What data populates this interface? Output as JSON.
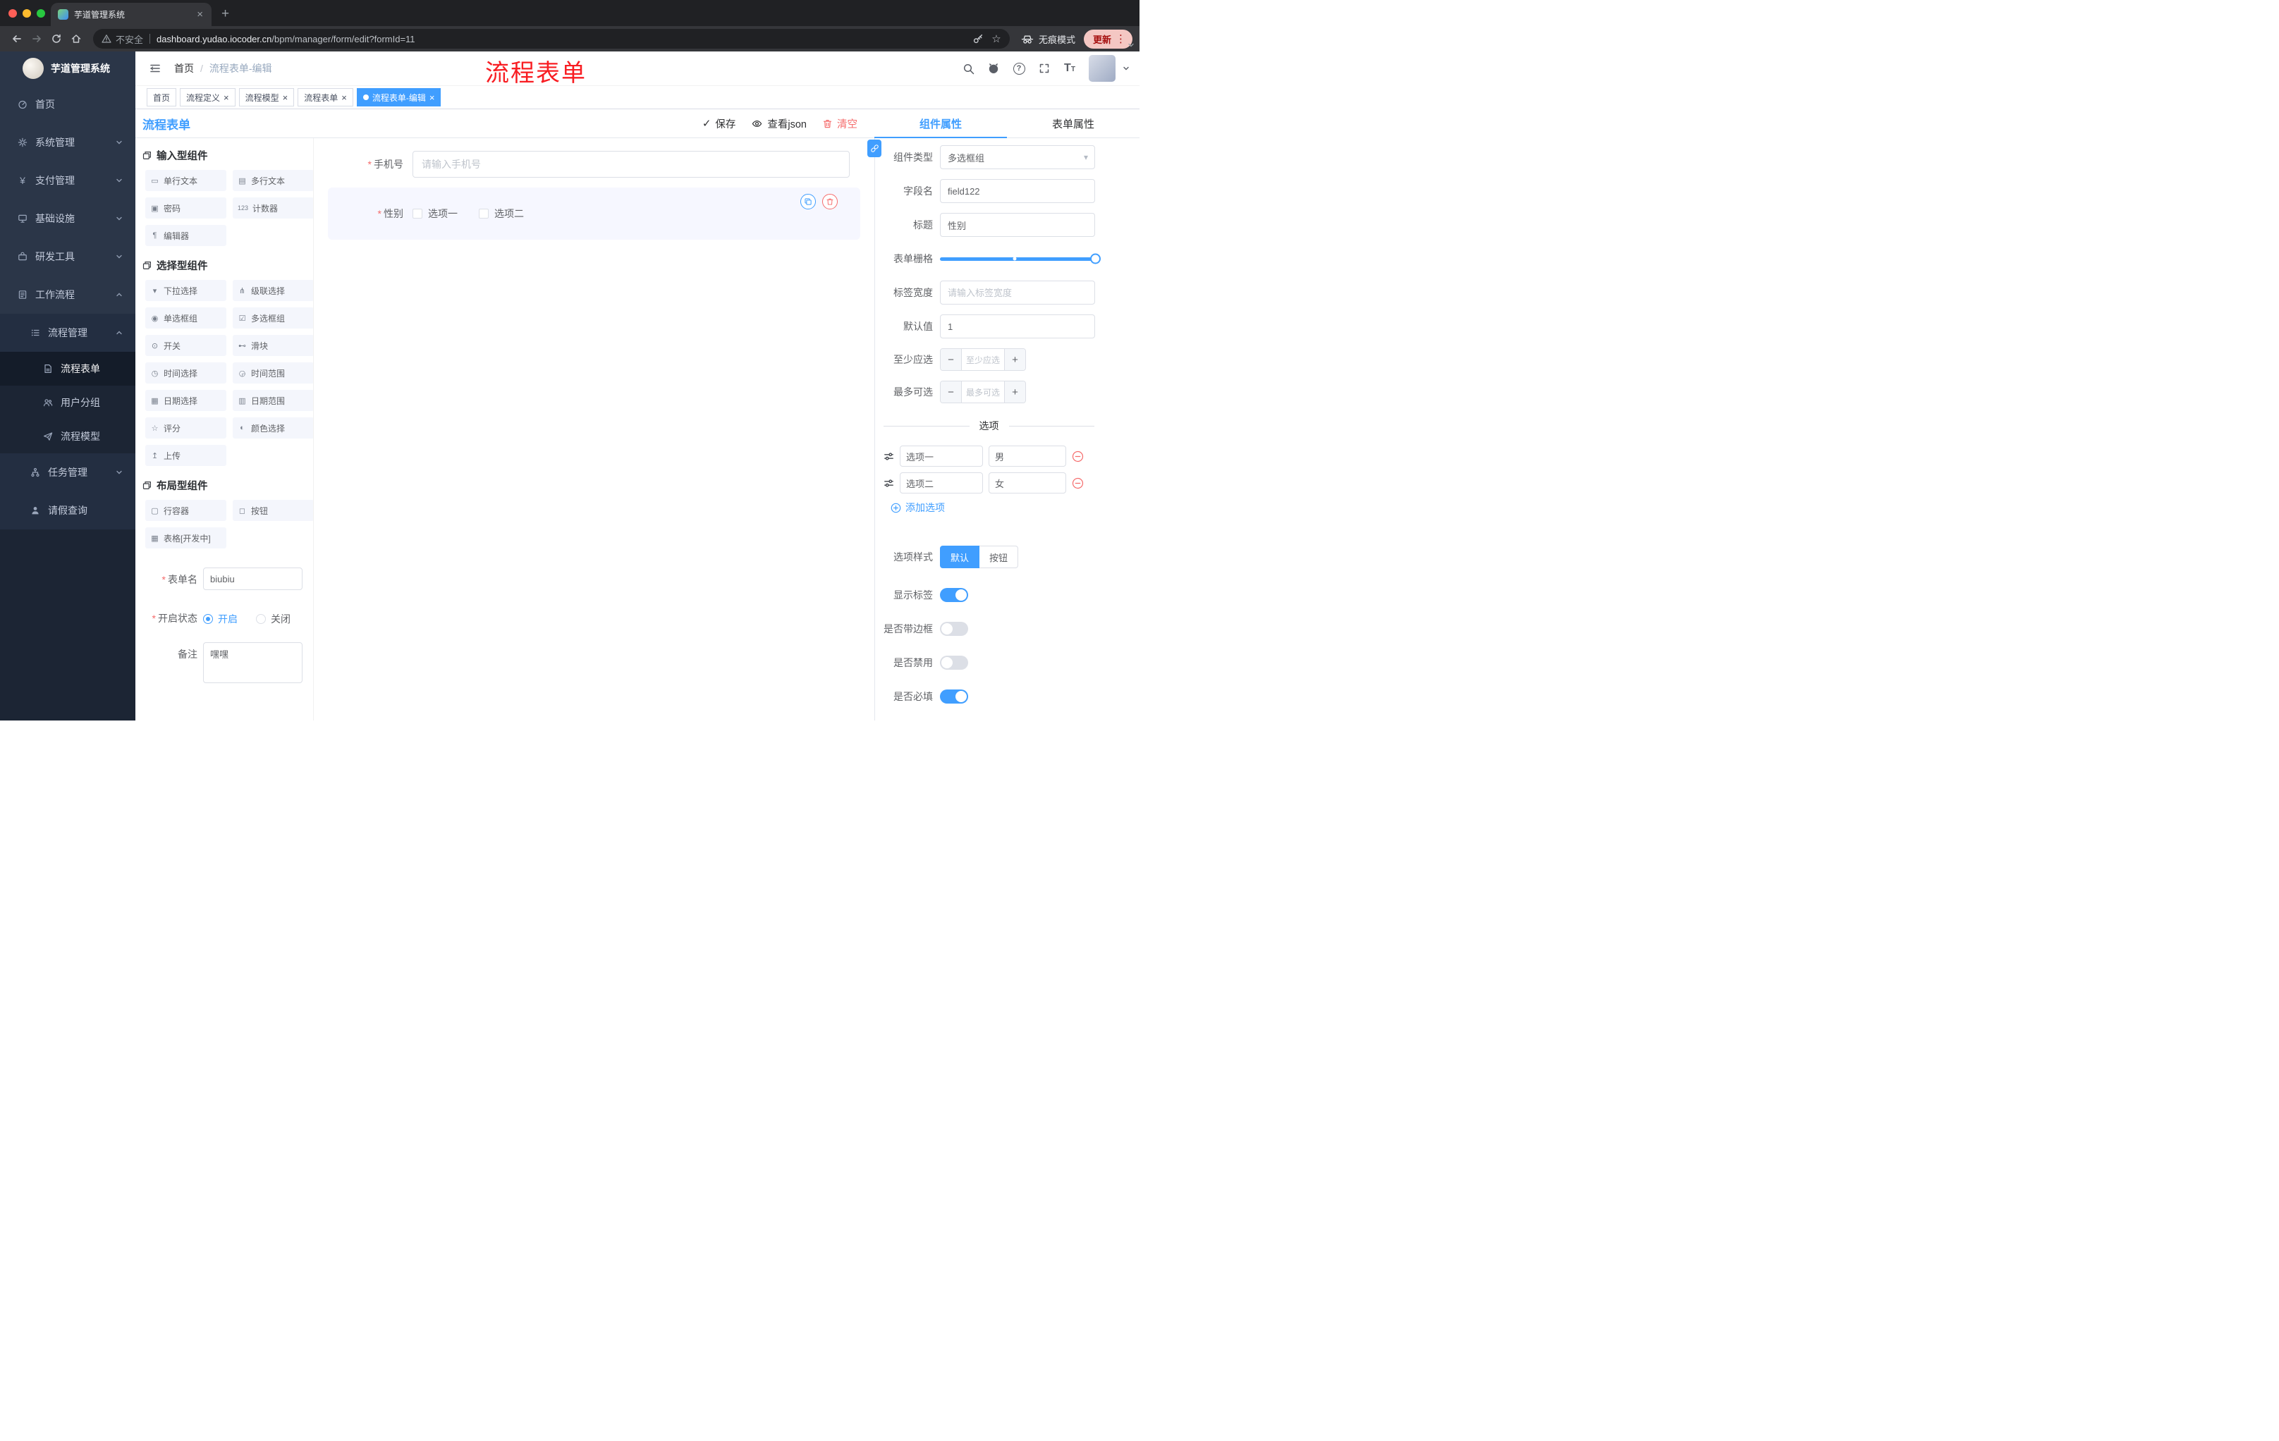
{
  "icons": {
    "close": "×",
    "plus": "+",
    "kebab": "⋮",
    "check": "✓",
    "star": "☆",
    "caret": "▾",
    "question": "?",
    "yen": "¥",
    "font_size_large": "T",
    "font_size_small": "T"
  },
  "browser": {
    "tab_title": "芋道管理系统",
    "security_label": "不安全",
    "url_host": "dashboard.yudao.iocoder.cn",
    "url_path": "/bpm/manager/form/edit?formId=11",
    "incognito_label": "无痕模式",
    "update_label": "更新"
  },
  "sidebar": {
    "title": "芋道管理系统",
    "items": [
      {
        "label": "首页"
      },
      {
        "label": "系统管理"
      },
      {
        "label": "支付管理"
      },
      {
        "label": "基础设施"
      },
      {
        "label": "研发工具"
      },
      {
        "label": "工作流程"
      },
      {
        "label": "流程管理"
      },
      {
        "label": "流程表单"
      },
      {
        "label": "用户分组"
      },
      {
        "label": "流程模型"
      },
      {
        "label": "任务管理"
      },
      {
        "label": "请假查询"
      }
    ]
  },
  "header": {
    "breadcrumb_home": "首页",
    "breadcrumb_current": "流程表单-编辑",
    "annotation": "流程表单"
  },
  "tags": [
    {
      "label": "首页"
    },
    {
      "label": "流程定义"
    },
    {
      "label": "流程模型"
    },
    {
      "label": "流程表单"
    },
    {
      "label": "流程表单-编辑"
    }
  ],
  "designer": {
    "title": "流程表单",
    "save_label": "保存",
    "view_json_label": "查看json",
    "clear_label": "清空",
    "groups": [
      {
        "title": "输入型组件",
        "items": [
          {
            "label": "单行文本",
            "glyph": "▭"
          },
          {
            "label": "多行文本",
            "glyph": "▤"
          },
          {
            "label": "密码",
            "glyph": "▣"
          },
          {
            "label": "计数器",
            "glyph": "123"
          },
          {
            "label": "编辑器",
            "glyph": "¶"
          }
        ]
      },
      {
        "title": "选择型组件",
        "items": [
          {
            "label": "下拉选择",
            "glyph": "▾"
          },
          {
            "label": "级联选择",
            "glyph": "⋔"
          },
          {
            "label": "单选框组",
            "glyph": "◉"
          },
          {
            "label": "多选框组",
            "glyph": "☑"
          },
          {
            "label": "开关",
            "glyph": "⊙"
          },
          {
            "label": "滑块",
            "glyph": "⊷"
          },
          {
            "label": "时间选择",
            "glyph": "◷"
          },
          {
            "label": "时间范围",
            "glyph": "◶"
          },
          {
            "label": "日期选择",
            "glyph": "▦"
          },
          {
            "label": "日期范围",
            "glyph": "▥"
          },
          {
            "label": "评分",
            "glyph": "☆"
          },
          {
            "label": "颜色选择",
            "glyph": "◐"
          },
          {
            "label": "上传",
            "glyph": "↥"
          }
        ]
      },
      {
        "title": "布局型组件",
        "items": [
          {
            "label": "行容器",
            "glyph": "▢"
          },
          {
            "label": "按钮",
            "glyph": "◻"
          },
          {
            "label": "表格[开发中]",
            "glyph": "▦"
          }
        ]
      }
    ],
    "meta": {
      "name_label": "表单名",
      "name_value": "biubiu",
      "status_label": "开启状态",
      "status_on": "开启",
      "status_off": "关闭",
      "remark_label": "备注",
      "remark_value": "嘿嘿"
    },
    "canvas": {
      "phone_label": "手机号",
      "phone_placeholder": "请输入手机号",
      "gender_label": "性别",
      "gender_opt1": "选项一",
      "gender_opt2": "选项二"
    }
  },
  "props": {
    "tab_component": "组件属性",
    "tab_form": "表单属性",
    "component_type_label": "组件类型",
    "component_type_value": "多选框组",
    "field_name_label": "字段名",
    "field_name_value": "field122",
    "title_label": "标题",
    "title_value": "性别",
    "grid_label": "表单栅格",
    "label_width_label": "标签宽度",
    "label_width_placeholder": "请输入标签宽度",
    "default_label": "默认值",
    "default_value": "1",
    "min_label": "至少应选",
    "min_placeholder": "至少应选",
    "max_label": "最多可选",
    "max_placeholder": "最多可选",
    "options_divider": "选项",
    "options": [
      {
        "label": "选项一",
        "value": "男"
      },
      {
        "label": "选项二",
        "value": "女"
      }
    ],
    "add_option_label": "添加选项",
    "option_style_label": "选项样式",
    "style_default": "默认",
    "style_button": "按钮",
    "switch_show_label": "显示标签",
    "switch_border": "是否带边框",
    "switch_disabled": "是否禁用",
    "switch_required": "是否必填"
  }
}
